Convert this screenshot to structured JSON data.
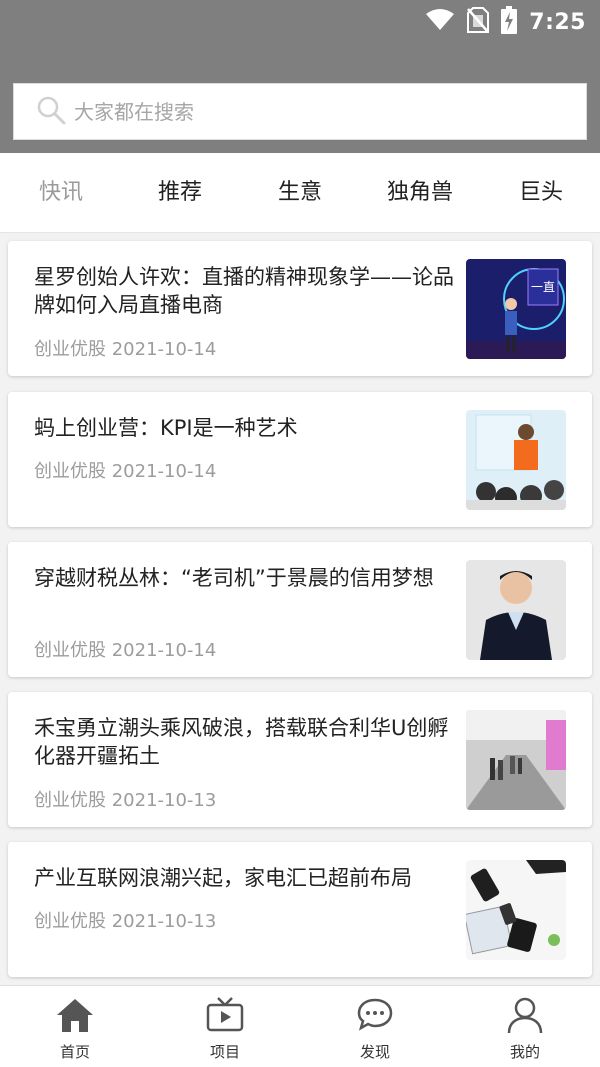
{
  "status_bar": {
    "time": "7:25",
    "icons": [
      "wifi-icon",
      "no-sim-icon",
      "battery-charging-icon"
    ]
  },
  "search": {
    "placeholder": "大家都在搜索",
    "icon": "search-icon"
  },
  "tabs": [
    {
      "label": "快讯",
      "active": true
    },
    {
      "label": "推荐",
      "active": false
    },
    {
      "label": "生意",
      "active": false
    },
    {
      "label": "独角兽",
      "active": false
    },
    {
      "label": "巨头",
      "active": false
    }
  ],
  "articles": [
    {
      "title": "星罗创始人许欢：直播的精神现象学——论品牌如何入局直播电商",
      "source": "创业优股",
      "date": "2021-10-14",
      "meta": "创业优股 2021-10-14"
    },
    {
      "title": "蚂上创业营：KPI是一种艺术",
      "source": "创业优股",
      "date": "2021-10-14",
      "meta": "创业优股 2021-10-14"
    },
    {
      "title": "穿越财税丛林：“老司机”于景晨的信用梦想",
      "source": "创业优股",
      "date": "2021-10-14",
      "meta": "创业优股 2021-10-14"
    },
    {
      "title": "禾宝勇立潮头乘风破浪，搭载联合利华U创孵化器开疆拓土",
      "source": "创业优股",
      "date": "2021-10-13",
      "meta": "创业优股 2021-10-13"
    },
    {
      "title": "产业互联网浪潮兴起，家电汇已超前布局",
      "source": "创业优股",
      "date": "2021-10-13",
      "meta": "创业优股 2021-10-13"
    }
  ],
  "bottom_nav": [
    {
      "label": "首页",
      "icon": "home-icon"
    },
    {
      "label": "项目",
      "icon": "tv-icon"
    },
    {
      "label": "发现",
      "icon": "chat-bubble-icon"
    },
    {
      "label": "我的",
      "icon": "user-icon"
    }
  ],
  "colors": {
    "header_bg": "#7f7f7f",
    "active_tab": "#9a9a9a",
    "meta_text": "#9c9c9c"
  }
}
